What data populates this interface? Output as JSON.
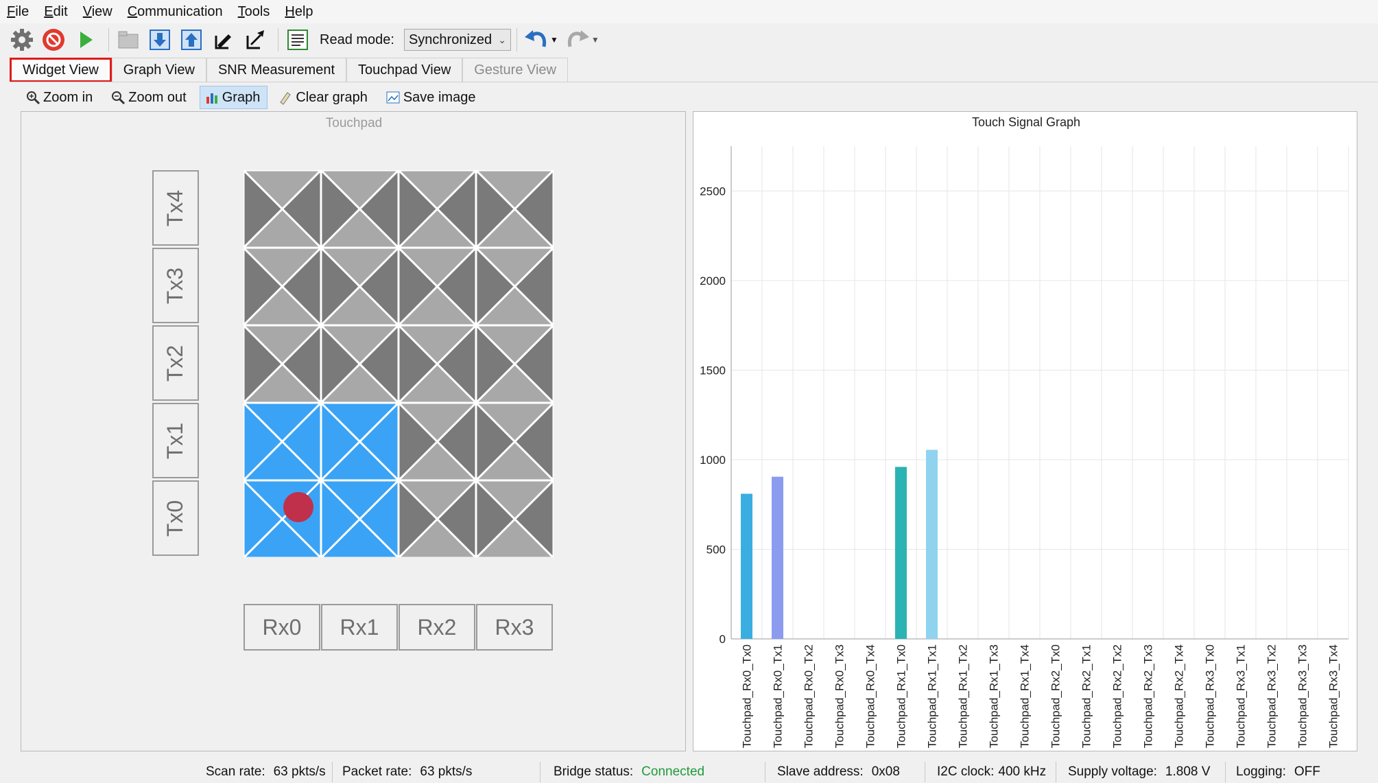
{
  "menu": [
    {
      "label": "File",
      "key": "F",
      "rest": "ile"
    },
    {
      "label": "Edit",
      "key": "E",
      "rest": "dit"
    },
    {
      "label": "View",
      "key": "V",
      "rest": "iew"
    },
    {
      "label": "Communication",
      "key": "C",
      "rest": "ommunication"
    },
    {
      "label": "Tools",
      "key": "T",
      "rest": "ools"
    },
    {
      "label": "Help",
      "key": "H",
      "rest": "elp"
    }
  ],
  "toolbar": {
    "icons": [
      "gear-icon",
      "stop-icon",
      "play-icon",
      "open-folder-icon",
      "download-icon",
      "upload-icon",
      "import-icon",
      "export-icon",
      "log-icon",
      "undo-icon",
      "redo-icon"
    ],
    "read_mode_label": "Read mode:",
    "read_mode_value": "Synchronized"
  },
  "tabs": [
    {
      "label": "Widget View",
      "active": true,
      "disabled": false
    },
    {
      "label": "Graph View",
      "active": false,
      "disabled": false
    },
    {
      "label": "SNR Measurement",
      "active": false,
      "disabled": false
    },
    {
      "label": "Touchpad View",
      "active": false,
      "disabled": false
    },
    {
      "label": "Gesture View",
      "active": false,
      "disabled": true
    }
  ],
  "subtoolbar": {
    "zoom_in": "Zoom in",
    "zoom_out": "Zoom out",
    "graph": "Graph",
    "clear_graph": "Clear graph",
    "save_image": "Save image"
  },
  "touchpad": {
    "title": "Touchpad",
    "tx_labels": [
      "Tx4",
      "Tx3",
      "Tx2",
      "Tx1",
      "Tx0"
    ],
    "rx_labels": [
      "Rx0",
      "Rx1",
      "Rx2",
      "Rx3"
    ],
    "active_cells": [
      [
        1,
        0
      ],
      [
        1,
        1
      ],
      [
        0,
        0
      ],
      [
        0,
        1
      ]
    ],
    "colors": {
      "active": "#3aa3f5",
      "inactive_dark": "#7a7a7a",
      "inactive_light": "#a8a8a8",
      "touch_dot": "#c1304a"
    }
  },
  "chart_data": {
    "type": "bar",
    "title": "Touch Signal Graph",
    "categories": [
      "Touchpad_Rx0_Tx0",
      "Touchpad_Rx0_Tx1",
      "Touchpad_Rx0_Tx2",
      "Touchpad_Rx0_Tx3",
      "Touchpad_Rx0_Tx4",
      "Touchpad_Rx1_Tx0",
      "Touchpad_Rx1_Tx1",
      "Touchpad_Rx1_Tx2",
      "Touchpad_Rx1_Tx3",
      "Touchpad_Rx1_Tx4",
      "Touchpad_Rx2_Tx0",
      "Touchpad_Rx2_Tx1",
      "Touchpad_Rx2_Tx2",
      "Touchpad_Rx2_Tx3",
      "Touchpad_Rx2_Tx4",
      "Touchpad_Rx3_Tx0",
      "Touchpad_Rx3_Tx1",
      "Touchpad_Rx3_Tx2",
      "Touchpad_Rx3_Tx3",
      "Touchpad_Rx3_Tx4"
    ],
    "values": [
      810,
      905,
      0,
      0,
      0,
      960,
      1055,
      0,
      0,
      0,
      0,
      0,
      0,
      0,
      0,
      0,
      0,
      0,
      0,
      0
    ],
    "colors": [
      "#3aaee0",
      "#8b9cf0",
      "#3aaee0",
      "#3aaee0",
      "#3aaee0",
      "#2bb3b3",
      "#8fd3ef",
      "#3aaee0",
      "#3aaee0",
      "#3aaee0",
      "#3aaee0",
      "#3aaee0",
      "#3aaee0",
      "#3aaee0",
      "#3aaee0",
      "#3aaee0",
      "#3aaee0",
      "#3aaee0",
      "#3aaee0",
      "#3aaee0"
    ],
    "yticks": [
      0,
      500,
      1000,
      1500,
      2000,
      2500
    ],
    "ylim": [
      0,
      2750
    ],
    "grid": true,
    "xlabel": "",
    "ylabel": ""
  },
  "status": {
    "scan_rate_label": "Scan rate:",
    "scan_rate_value": "63 pkts/s",
    "packet_rate_label": "Packet rate:",
    "packet_rate_value": "63 pkts/s",
    "bridge_status_label": "Bridge status:",
    "bridge_status_value": "Connected",
    "slave_address_label": "Slave address:",
    "slave_address_value": "0x08",
    "i2c_clock_label": "I2C clock:",
    "i2c_clock_value": "400 kHz",
    "supply_voltage_label": "Supply voltage:",
    "supply_voltage_value": "1.808 V",
    "logging_label": "Logging:",
    "logging_value": "OFF"
  }
}
